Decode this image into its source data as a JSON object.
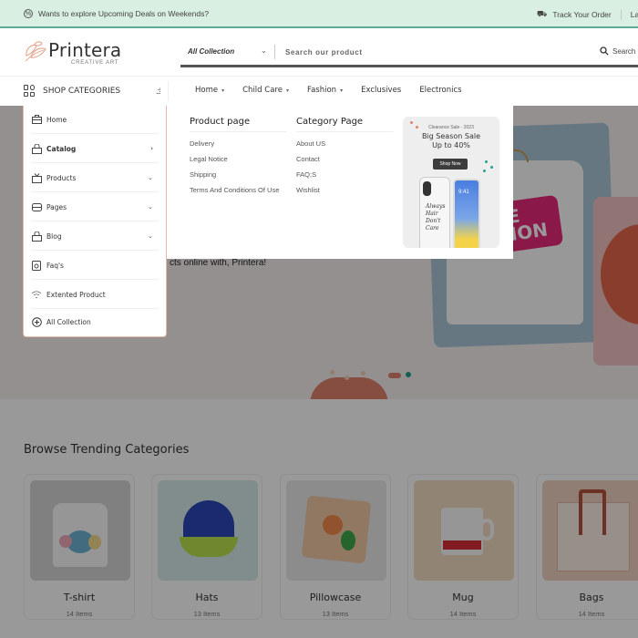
{
  "topbar": {
    "promo_icon": "percent-circle-icon",
    "promo_text": "Wants to explore Upcoming Deals on Weekends?",
    "track_icon": "truck-icon",
    "track_label": "Track Your Order",
    "language_label": "Lang"
  },
  "header": {
    "logo": {
      "name": "Printera",
      "tagline": "CREATIVE ART"
    },
    "search": {
      "collection_selected": "All Collection",
      "placeholder": "Search our product",
      "value": "",
      "button_label": "Search"
    }
  },
  "navbar": {
    "shop_categories_label": "SHOP CATEGORIES",
    "menu": [
      {
        "label": "Home",
        "has_dropdown": true
      },
      {
        "label": "Child Care",
        "has_dropdown": true
      },
      {
        "label": "Fashion",
        "has_dropdown": true
      },
      {
        "label": "Exclusives",
        "has_dropdown": false
      },
      {
        "label": "Electronics",
        "has_dropdown": false
      }
    ]
  },
  "category_dropdown": {
    "items": [
      {
        "label": "Home",
        "icon": "briefcase-icon",
        "arrow": ""
      },
      {
        "label": "Catalog",
        "icon": "bag-icon",
        "arrow": "›"
      },
      {
        "label": "Products",
        "icon": "tv-icon",
        "arrow": "⌄"
      },
      {
        "label": "Pages",
        "icon": "inbox-icon",
        "arrow": "⌄"
      },
      {
        "label": "Blog",
        "icon": "bag-icon",
        "arrow": "⌄"
      },
      {
        "label": "Faq's",
        "icon": "speaker-icon",
        "arrow": ""
      },
      {
        "label": "Extented Product",
        "icon": "wifi-icon",
        "arrow": ""
      },
      {
        "label": "All Collection",
        "icon": "plus-circle-icon",
        "arrow": ""
      }
    ]
  },
  "mega_menu": {
    "columns": [
      {
        "title": "Product page",
        "links": [
          "Delivery",
          "Legal Notice",
          "Shipping",
          "Terms And Conditions Of Use"
        ]
      },
      {
        "title": "Category Page",
        "links": [
          "About US",
          "Contact",
          "FAQ;S",
          "Wishlist"
        ]
      }
    ],
    "promo": {
      "subtitle": "Clearance Sale - 2023",
      "title_line1": "Big Season Sale",
      "title_line2": "Up to 40%",
      "button_label": "Shop Now",
      "phone_time": "9:41",
      "case_text": "Always Hair Don't Care"
    }
  },
  "hero": {
    "tagline_visible": "cts online with, Printera!",
    "shirt_print": "TAKE ACTION"
  },
  "trending": {
    "title": "Browse Trending Categories",
    "categories": [
      {
        "name": "T-shirt",
        "count": "14 Items",
        "image": "tshirt-image",
        "bg": "#d5d5d5"
      },
      {
        "name": "Hats",
        "count": "13 Items",
        "image": "hat-image",
        "bg": "#d8ecea"
      },
      {
        "name": "Pillowcase",
        "count": "13 Items",
        "image": "pillow-image",
        "bg": "#e9e9e9"
      },
      {
        "name": "Mug",
        "count": "14 Items",
        "image": "mug-image",
        "bg": "#f3dcc4"
      },
      {
        "name": "Bags",
        "count": "14 Items",
        "image": "bag-image",
        "bg": "#f1d2c3"
      }
    ]
  },
  "colors": {
    "topbar_bg": "#d8efe2",
    "accent_teal": "#5aa99a",
    "accent_coral": "#e0826b",
    "overlay": "rgba(0,0,0,0.4)"
  }
}
